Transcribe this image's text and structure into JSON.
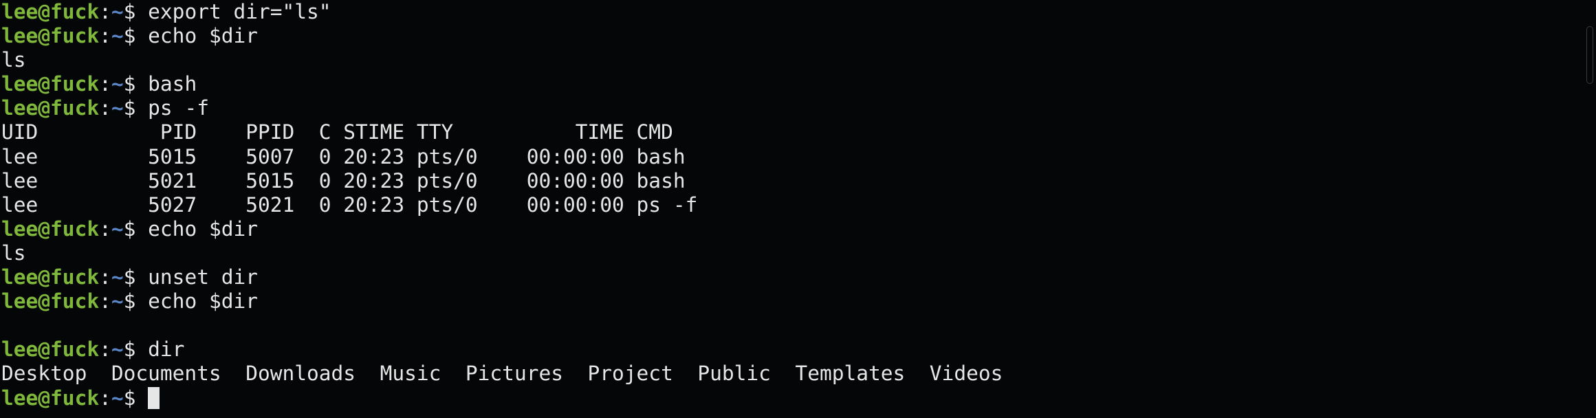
{
  "prompt": {
    "user_host": "lee@fuck",
    "colon": ":",
    "path": "~",
    "dollar": "$ "
  },
  "lines": [
    {
      "type": "cmd",
      "text": "export dir=\"ls\""
    },
    {
      "type": "cmd",
      "text": "echo $dir"
    },
    {
      "type": "out",
      "text": "ls"
    },
    {
      "type": "cmd",
      "text": "bash"
    },
    {
      "type": "cmd",
      "text": "ps -f"
    },
    {
      "type": "out",
      "text": "UID          PID    PPID  C STIME TTY          TIME CMD"
    },
    {
      "type": "out",
      "text": "lee         5015    5007  0 20:23 pts/0    00:00:00 bash"
    },
    {
      "type": "out",
      "text": "lee         5021    5015  0 20:23 pts/0    00:00:00 bash"
    },
    {
      "type": "out",
      "text": "lee         5027    5021  0 20:23 pts/0    00:00:00 ps -f"
    },
    {
      "type": "cmd",
      "text": "echo $dir"
    },
    {
      "type": "out",
      "text": "ls"
    },
    {
      "type": "cmd",
      "text": "unset dir"
    },
    {
      "type": "cmd",
      "text": "echo $dir"
    },
    {
      "type": "out",
      "text": ""
    },
    {
      "type": "cmd",
      "text": "dir"
    },
    {
      "type": "out",
      "text": "Desktop  Documents  Downloads  Music  Pictures  Project  Public  Templates  Videos"
    },
    {
      "type": "cmd",
      "text": "",
      "cursor": true
    }
  ],
  "colors": {
    "background": "#050608",
    "foreground": "#e6e6e6",
    "user_host": "#7fb83b",
    "path": "#5a86c7",
    "cursor": "#e6e6e6"
  }
}
